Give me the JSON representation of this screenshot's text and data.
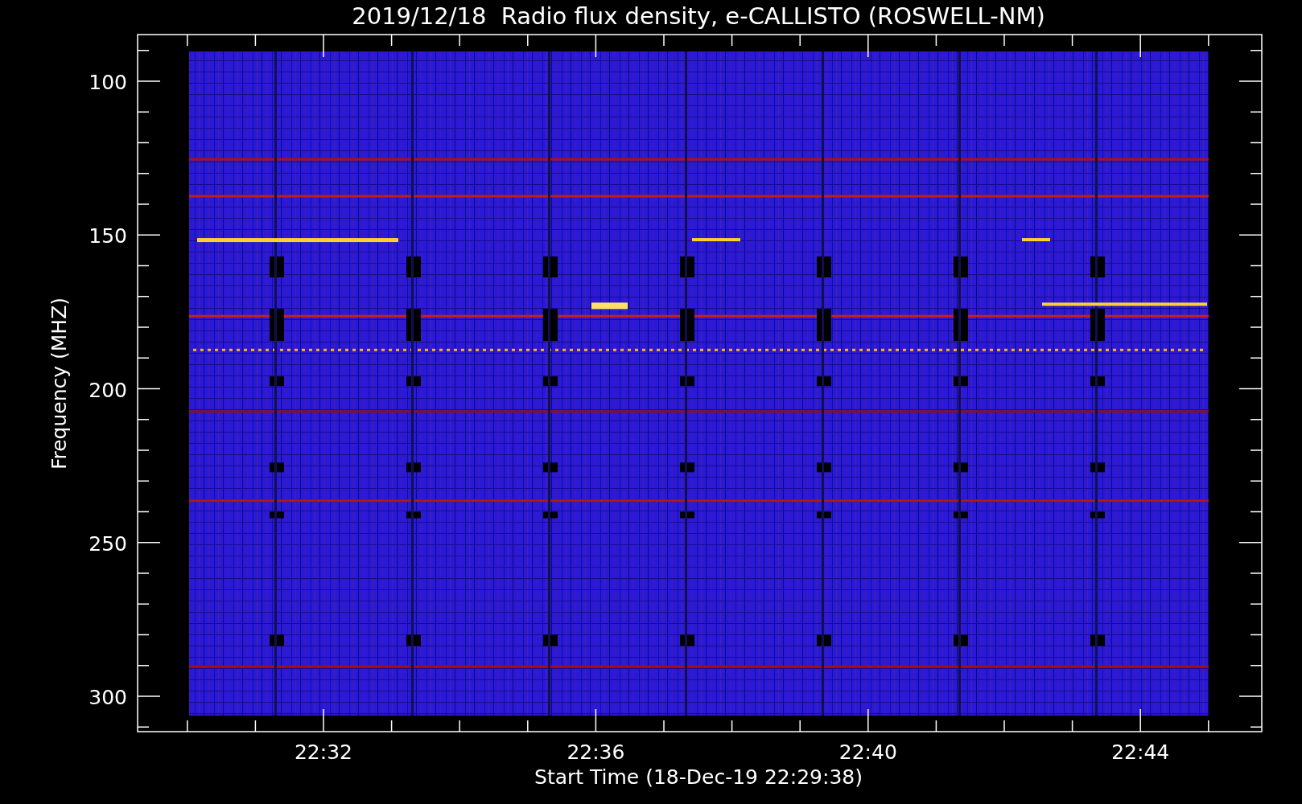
{
  "title": "2019/12/18  Radio flux density, e-CALLISTO (ROSWELL-NM)",
  "y_axis": {
    "label": "Frequency (MHZ)",
    "ticks": [
      "100",
      "150",
      "200",
      "250",
      "300"
    ]
  },
  "x_axis": {
    "label": "Start Time (18-Dec-19 22:29:38)",
    "ticks": [
      "22:32",
      "22:36",
      "22:40",
      "22:44"
    ]
  }
}
